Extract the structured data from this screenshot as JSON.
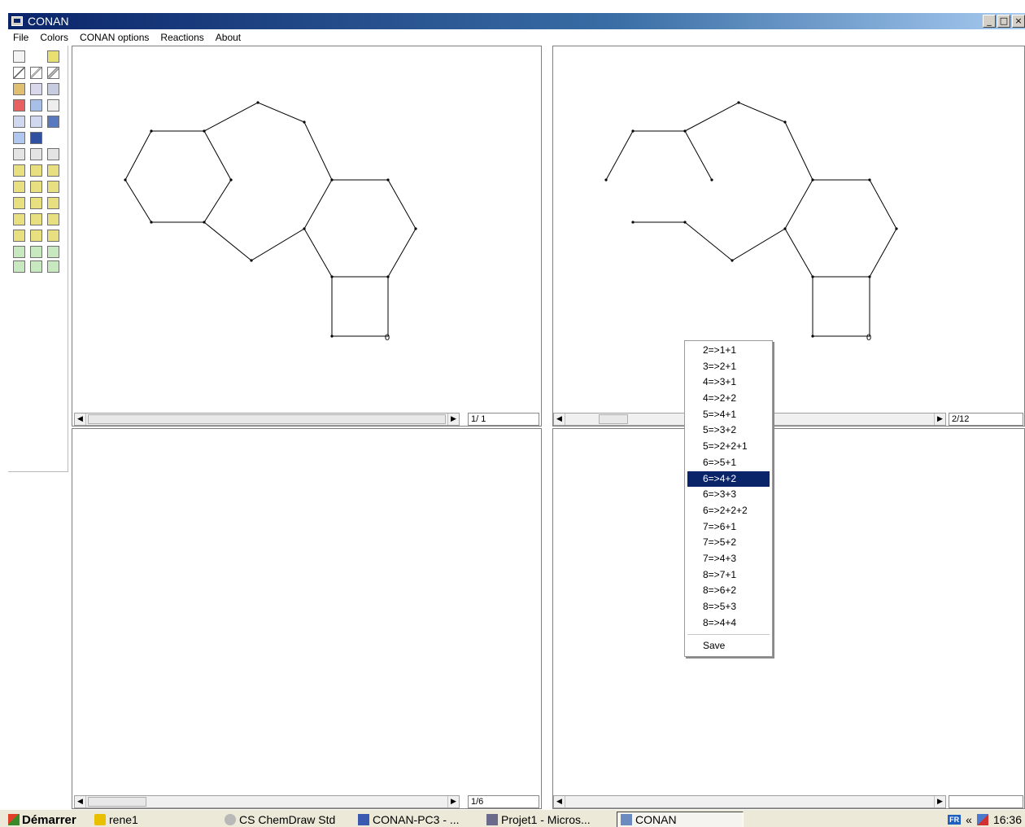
{
  "window": {
    "title": "CONAN"
  },
  "window_controls": {
    "minimize": "_",
    "maximize": "□",
    "close": "×"
  },
  "menu": [
    "File",
    "Colors",
    "CONAN options",
    "Reactions",
    "About"
  ],
  "panes": {
    "top_left": {
      "counter": "1/ 1",
      "node_label": "0"
    },
    "top_right": {
      "counter": "2/12",
      "node_label": "0"
    },
    "bottom_left": {
      "counter": "1/6"
    },
    "bottom_right": {
      "counter": ""
    }
  },
  "context_menu": {
    "items": [
      "2=>1+1",
      "3=>2+1",
      "4=>3+1",
      "4=>2+2",
      "5=>4+1",
      "5=>3+2",
      "5=>2+2+1",
      "6=>5+1",
      "6=>4+2",
      "6=>3+3",
      "6=>2+2+2",
      "7=>6+1",
      "7=>5+2",
      "7=>4+3",
      "8=>7+1",
      "8=>6+2",
      "8=>5+3",
      "8=>4+4"
    ],
    "selected": "6=>4+2",
    "save": "Save"
  },
  "taskbar": {
    "start": "Démarrer",
    "tasks": [
      "rene1",
      "CS ChemDraw Std",
      "CONAN-PC3 - ...",
      "Projet1 - Micros...",
      "CONAN"
    ],
    "active_task": "CONAN",
    "language": "FR",
    "chevron": "«",
    "clock": "16:36"
  },
  "colors": {
    "title_bar": "#0a246a",
    "selection": "#0a246a",
    "start_icon": "#3a8a2a",
    "folder": "#e8c000"
  }
}
